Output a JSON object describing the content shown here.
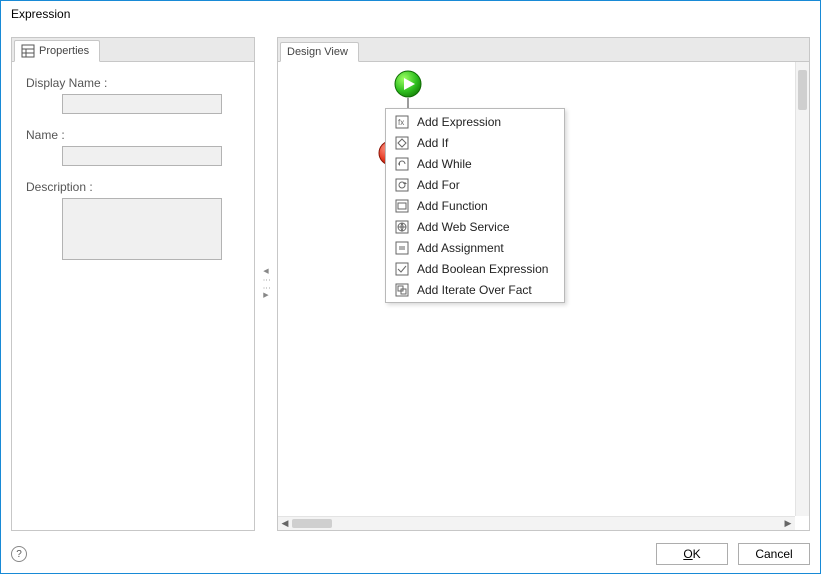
{
  "window": {
    "title": "Expression"
  },
  "leftPanel": {
    "tabLabel": "Properties",
    "fields": {
      "displayName": {
        "label": "Display Name :",
        "value": ""
      },
      "name": {
        "label": "Name :",
        "value": ""
      },
      "description": {
        "label": "Description :",
        "value": ""
      }
    }
  },
  "rightPanel": {
    "tabLabel": "Design View",
    "contextMenu": {
      "items": [
        {
          "label": "Add Expression"
        },
        {
          "label": "Add If"
        },
        {
          "label": "Add While"
        },
        {
          "label": "Add For"
        },
        {
          "label": "Add Function"
        },
        {
          "label": "Add Web Service"
        },
        {
          "label": "Add Assignment"
        },
        {
          "label": "Add Boolean Expression"
        },
        {
          "label": "Add Iterate Over Fact"
        }
      ]
    }
  },
  "buttons": {
    "ok": "OK",
    "cancel": "Cancel"
  }
}
